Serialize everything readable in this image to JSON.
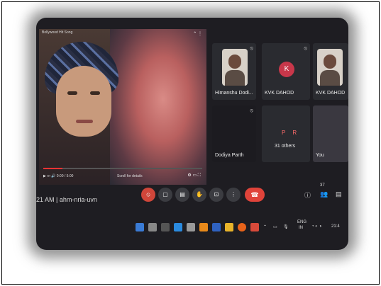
{
  "video": {
    "title": "Bollywood Hit Song",
    "time": "0:00 / 5:00",
    "mid_text": "Scroll for details",
    "progress": 0.12
  },
  "tiles": {
    "himanshu": "Himanshu Dodi...",
    "kvk1_initial": "K",
    "kvk1": "KVK DAHOD",
    "kvk2": "KVK DAHOD",
    "dodiya": "Dodiya Parth",
    "others_badges": "P R",
    "others_count": "31 others",
    "you": "You"
  },
  "meeting": {
    "time": "21 AM",
    "code": "ahm-nria-uvn"
  },
  "controls": {
    "people_count": "37"
  },
  "tray": {
    "lang_top": "ENG",
    "lang_bottom": "IN",
    "clock": "21:4"
  },
  "colors": {
    "end_call": "#e0433a",
    "avatar": "#c8374a"
  }
}
